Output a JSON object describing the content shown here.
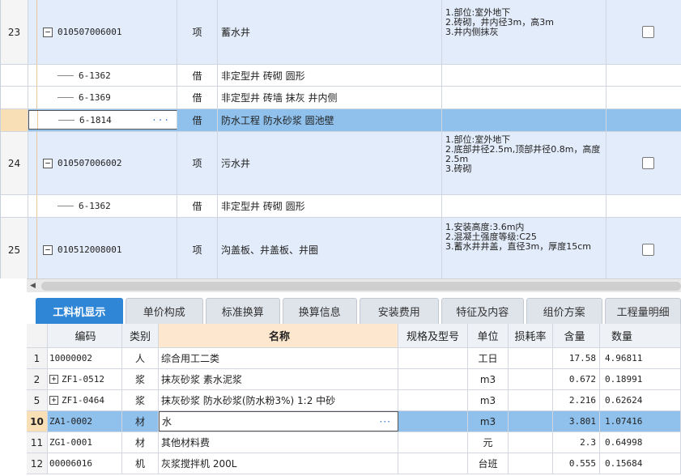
{
  "upper_rows": [
    {
      "kind": "main",
      "index": "23",
      "code": "010507006001",
      "unit": "项",
      "name": "蓄水井",
      "features": [
        "1.部位:室外地下",
        "2.砖砌，井内径3m，高3m",
        "3.井内侧抹灰"
      ]
    },
    {
      "kind": "sub",
      "code": "6-1362",
      "unit": "借",
      "name": "非定型井 砖砌 圆形"
    },
    {
      "kind": "sub",
      "code": "6-1369",
      "unit": "借",
      "name": "非定型井 砖墙 抹灰 井内侧"
    },
    {
      "kind": "sel",
      "code": "6-1814",
      "unit": "借",
      "name": "防水工程 防水砂浆 圆池壁"
    },
    {
      "kind": "main",
      "index": "24",
      "code": "010507006002",
      "unit": "项",
      "name": "污水井",
      "features": [
        "1.部位:室外地下",
        "2.底部井径2.5m,顶部井径0.8m，高度2.5m",
        "3.砖砌"
      ]
    },
    {
      "kind": "sub",
      "code": "6-1362",
      "unit": "借",
      "name": "非定型井 砖砌 圆形"
    },
    {
      "kind": "main",
      "index": "25",
      "code": "010512008001",
      "unit": "项",
      "name": "沟盖板、井盖板、井圈",
      "features": [
        "1.安装高度:3.6m内",
        "2.混凝土强度等级:C25",
        "3.蓄水井井盖，直径3m，厚度15cm"
      ]
    }
  ],
  "tabs": [
    "工料机显示",
    "单价构成",
    "标准换算",
    "换算信息",
    "安装费用",
    "特征及内容",
    "组价方案",
    "工程量明细"
  ],
  "active_tab": "工料机显示",
  "lower_headers": {
    "code": "编码",
    "category": "类别",
    "name": "名称",
    "spec": "规格及型号",
    "unit": "单位",
    "loss": "损耗率",
    "content": "含量",
    "quantity": "数量"
  },
  "lower_rows": [
    {
      "index": "1",
      "code": "10000002",
      "expand": false,
      "category": "人",
      "name": "综合用工二类",
      "unit": "工日",
      "content": "17.58",
      "quantity": "4.96811"
    },
    {
      "index": "2",
      "code": "ZF1-0512",
      "expand": true,
      "category": "浆",
      "name": "抹灰砂浆 素水泥浆",
      "unit": "m3",
      "content": "0.672",
      "quantity": "0.18991"
    },
    {
      "index": "5",
      "code": "ZF1-0464",
      "expand": true,
      "category": "浆",
      "name": "抹灰砂浆 防水砂浆(防水粉3%) 1:2 中砂",
      "unit": "m3",
      "content": "2.216",
      "quantity": "0.62624"
    },
    {
      "index": "10",
      "code": "ZA1-0002",
      "expand": false,
      "category": "材",
      "name": "水",
      "unit": "m3",
      "content": "3.801",
      "quantity": "1.07416",
      "selected": true
    },
    {
      "index": "11",
      "code": "ZG1-0001",
      "expand": false,
      "category": "材",
      "name": "其他材料费",
      "unit": "元",
      "content": "2.3",
      "quantity": "0.64998"
    },
    {
      "index": "12",
      "code": "00006016",
      "expand": false,
      "category": "机",
      "name": "灰浆搅拌机 200L",
      "unit": "台班",
      "content": "0.555",
      "quantity": "0.15684"
    }
  ],
  "ellipsis": "···"
}
